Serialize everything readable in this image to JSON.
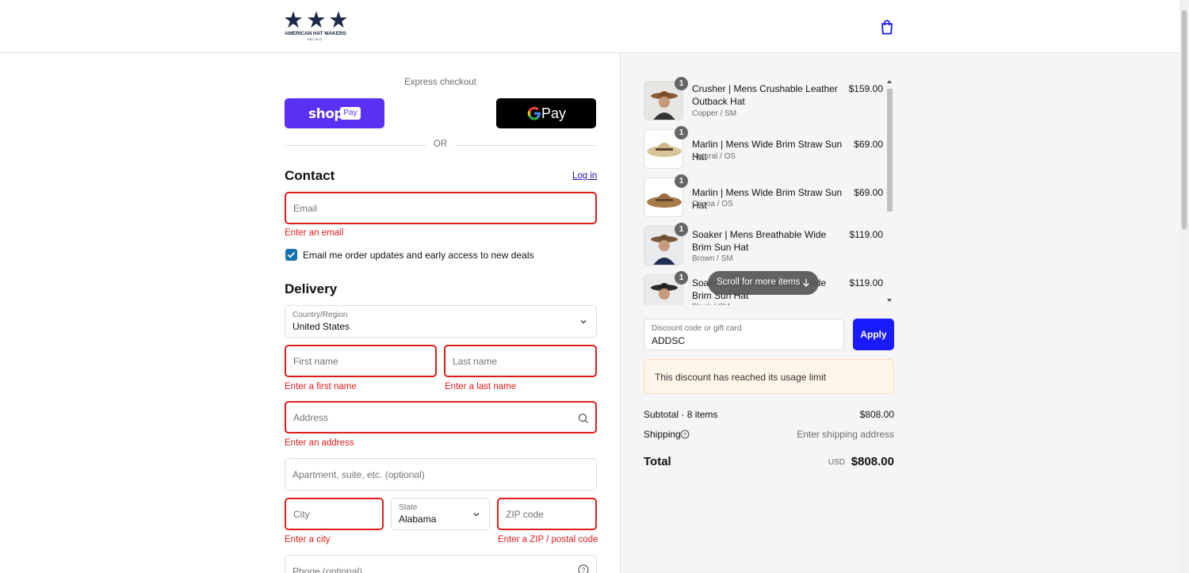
{
  "brand": {
    "logo_text": "AMERICAN HAT MAKERS",
    "logo_sub": "EST 1972",
    "cart_icon": "shopping-bag-icon"
  },
  "express": {
    "label": "Express checkout",
    "shop_pay_word": "shop",
    "shop_pay_badge": "Pay",
    "gpay_word": "Pay",
    "or_label": "OR"
  },
  "contact": {
    "title": "Contact",
    "login_label": "Log in",
    "email_placeholder": "Email",
    "email_error": "Enter an email",
    "marketing_label": "Email me order updates and early access to new deals",
    "marketing_checked": true
  },
  "delivery": {
    "title": "Delivery",
    "country_label": "Country/Region",
    "country_value": "United States",
    "first_name_placeholder": "First name",
    "first_name_error": "Enter a first name",
    "last_name_placeholder": "Last name",
    "last_name_error": "Enter a last name",
    "address_placeholder": "Address",
    "address_error": "Enter an address",
    "apartment_placeholder": "Apartment, suite, etc. (optional)",
    "city_placeholder": "City",
    "city_error": "Enter a city",
    "state_label": "State",
    "state_value": "Alabama",
    "zip_placeholder": "ZIP code",
    "zip_error": "Enter a ZIP / postal code",
    "phone_placeholder": "Phone (optional)"
  },
  "order": {
    "items": [
      {
        "title": "Crusher | Mens Crushable Leather Outback Hat",
        "variant": "Copper / SM",
        "price": "$159.00",
        "qty": "1"
      },
      {
        "title": "Marlin | Mens Wide Brim Straw Sun Hat",
        "variant": "Natural / OS",
        "price": "$69.00",
        "qty": "1"
      },
      {
        "title": "Marlin | Mens Wide Brim Straw Sun Hat",
        "variant": "Cocoa / OS",
        "price": "$69.00",
        "qty": "1"
      },
      {
        "title": "Soaker | Mens Breathable Wide Brim Sun Hat",
        "variant": "Brown / SM",
        "price": "$119.00",
        "qty": "1"
      },
      {
        "title": "Soaker | Mens Breathable Wide Brim Sun Hat",
        "variant": "Black / SM",
        "price": "$119.00",
        "qty": "1"
      }
    ],
    "scroll_hint": "Scroll for more items",
    "discount_label": "Discount code or gift card",
    "discount_value": "ADDSC",
    "apply_label": "Apply",
    "discount_notice": "This discount has reached its usage limit",
    "subtotal_label": "Subtotal · 8 items",
    "subtotal_value": "$808.00",
    "shipping_label": "Shipping",
    "shipping_value": "Enter shipping address",
    "total_label": "Total",
    "total_currency": "USD",
    "total_value": "$808.00"
  },
  "colors": {
    "shop_pay": "#5a31f4",
    "apply_button": "#1a1aff",
    "error": "#dd1d1d",
    "checkbox": "#1773b0",
    "notice_bg": "#fff4e8"
  }
}
